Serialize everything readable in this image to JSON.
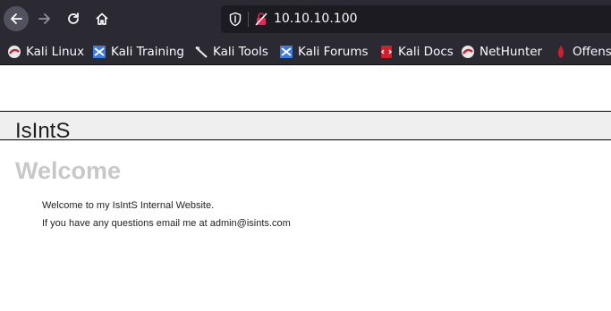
{
  "browser": {
    "url": "10.10.10.100",
    "bookmarks": [
      {
        "label": "Kali Linux",
        "icon": "kali-dragon-icon"
      },
      {
        "label": "Kali Training",
        "icon": "kali-training-icon"
      },
      {
        "label": "Kali Tools",
        "icon": "kali-tools-icon"
      },
      {
        "label": "Kali Forums",
        "icon": "kali-forums-icon"
      },
      {
        "label": "Kali Docs",
        "icon": "kali-docs-icon"
      },
      {
        "label": "NetHunter",
        "icon": "nethunter-icon"
      },
      {
        "label": "Offens",
        "icon": "offensive-security-icon"
      }
    ],
    "colors": {
      "toolbar": "#2b2a33",
      "urlbar": "#1c1b22",
      "text": "#fbfbfe"
    }
  },
  "page": {
    "site_name": "IsIntS",
    "heading": "Welcome",
    "paragraphs": [
      "Welcome to my IsIntS Internal Website.",
      "If you have any questions email me at admin@isints.com"
    ],
    "colors": {
      "header_bg": "#efefef",
      "heading": "#c8c8c8"
    }
  }
}
